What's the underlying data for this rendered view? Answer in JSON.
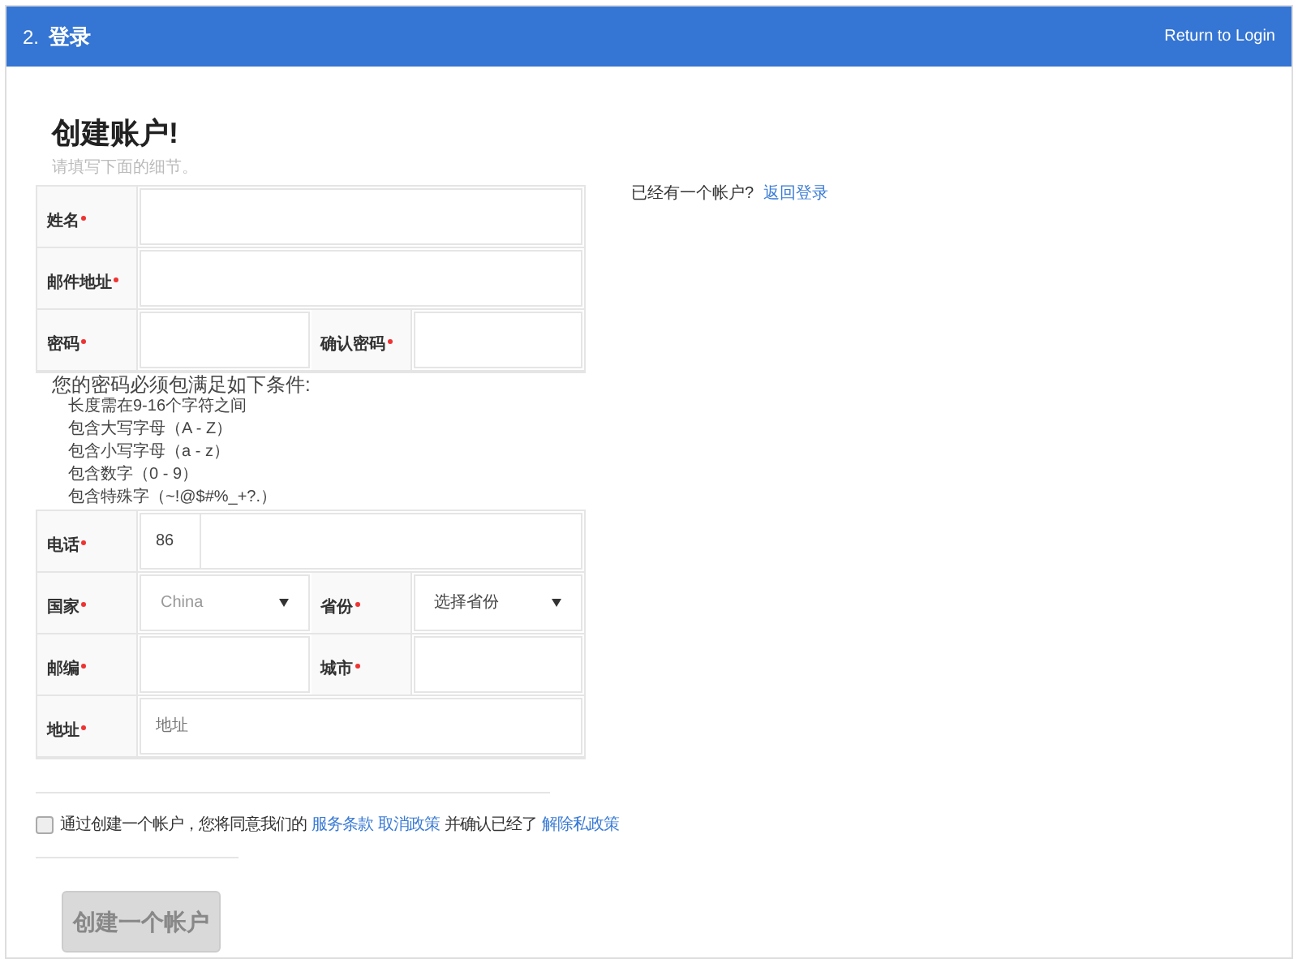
{
  "header": {
    "step": "2.",
    "title": "登录",
    "link": "Return to Login"
  },
  "form": {
    "title": "创建账户!",
    "subtitle": "请填写下面的细节。",
    "rows_top": [
      {
        "fields": [
          {
            "label": "姓名",
            "required": true,
            "kind": "input"
          }
        ]
      },
      {
        "fields": [
          {
            "label": "邮件地址",
            "required": true,
            "kind": "input"
          }
        ]
      },
      {
        "fields": [
          {
            "label": "密码",
            "required": true,
            "kind": "input"
          },
          {
            "label": "确认密码",
            "required": true,
            "kind": "input"
          }
        ]
      }
    ],
    "requirements": {
      "heading": "您的密码必须包满足如下条件:",
      "items": [
        "长度需在9-16个字符之间",
        "包含大写字母（A - Z）",
        "包含小写字母（a - z）",
        "包含数字（0 - 9）",
        "包含特殊字（~!@$#%_+?.）"
      ]
    },
    "rows_bottom": [
      {
        "fields": [
          {
            "label": "电话",
            "required": true,
            "kind": "phone",
            "prefix": "86"
          }
        ]
      },
      {
        "fields": [
          {
            "label": "国家",
            "required": true,
            "kind": "select",
            "value": "China",
            "muted": true
          },
          {
            "label": "省份",
            "required": true,
            "kind": "select",
            "value": "选择省份",
            "muted": false
          }
        ]
      },
      {
        "fields": [
          {
            "label": "邮编",
            "required": true,
            "kind": "input"
          },
          {
            "label": "城市",
            "required": true,
            "kind": "input"
          }
        ]
      },
      {
        "fields": [
          {
            "label": "地址",
            "required": true,
            "kind": "input",
            "placeholder": "地址"
          }
        ]
      }
    ],
    "agreement": {
      "checked": false,
      "parts": [
        {
          "kind": "text",
          "text": "通过创建一个帐户，您将同意我们的"
        },
        {
          "kind": "link",
          "text": "服务条款"
        },
        {
          "kind": "link",
          "text": "取消政策"
        },
        {
          "kind": "text",
          "text": "并确认已经了"
        },
        {
          "kind": "link",
          "text": "解除私政策"
        }
      ]
    },
    "submit": {
      "label": "创建一个帐户",
      "disabled": true
    }
  },
  "aside": {
    "text": "已经有一个帐户?",
    "link": "返回登录"
  }
}
